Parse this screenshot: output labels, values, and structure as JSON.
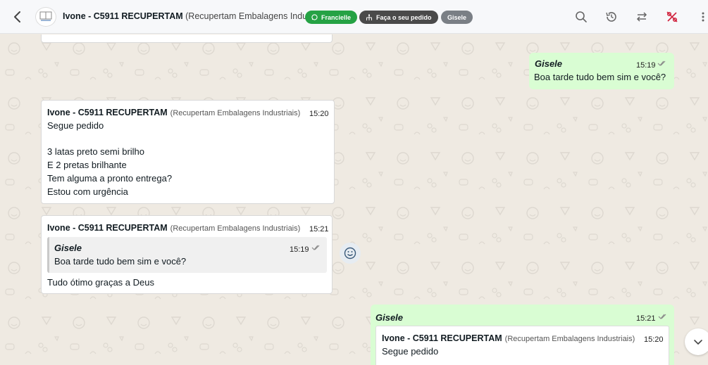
{
  "header": {
    "contact_name": "Ivone - C5911 RECUPERTAM",
    "contact_org": "(Recupertam Embalagens Industriais)",
    "tag_agent": "Francielle",
    "tag_order": "Faça o seu pedido",
    "tag_user": "Gisele",
    "colors": {
      "agent": "#25a244",
      "order": "#4a4a4a",
      "user": "#7a7f85"
    }
  },
  "messages": {
    "m0": {
      "sender": "Gisele",
      "time": "15:19",
      "text": "Boa tarde tudo bem sim e você?"
    },
    "m1": {
      "sender": "Ivone - C5911 RECUPERTAM",
      "org": "(Recupertam Embalagens Industriais)",
      "time": "15:20",
      "lines": [
        "Segue pedido",
        "3 latas preto semi brilho",
        "E 2 pretas brilhante",
        "Tem alguma a pronto entrega?",
        "Estou com urgência"
      ]
    },
    "m2": {
      "sender": "Ivone - C5911 RECUPERTAM",
      "org": "(Recupertam Embalagens Industriais)",
      "time": "15:21",
      "quote": {
        "sender": "Gisele",
        "time": "15:19",
        "text": "Boa tarde tudo bem sim e você?"
      },
      "text": "Tudo ótimo graças a Deus"
    },
    "m3": {
      "sender": "Gisele",
      "time": "15:21",
      "quote": {
        "sender": "Ivone - C5911 RECUPERTAM",
        "org": "(Recupertam Embalagens Industriais)",
        "time": "15:20",
        "text": "Segue pedido"
      }
    }
  },
  "icons": [
    "back-arrow-icon",
    "whatsapp-icon",
    "org-chart-icon",
    "search-icon",
    "history-icon",
    "transfer-icon",
    "percent-icon",
    "more-icon",
    "emoji-icon",
    "chevron-down-icon",
    "double-check-icon"
  ]
}
